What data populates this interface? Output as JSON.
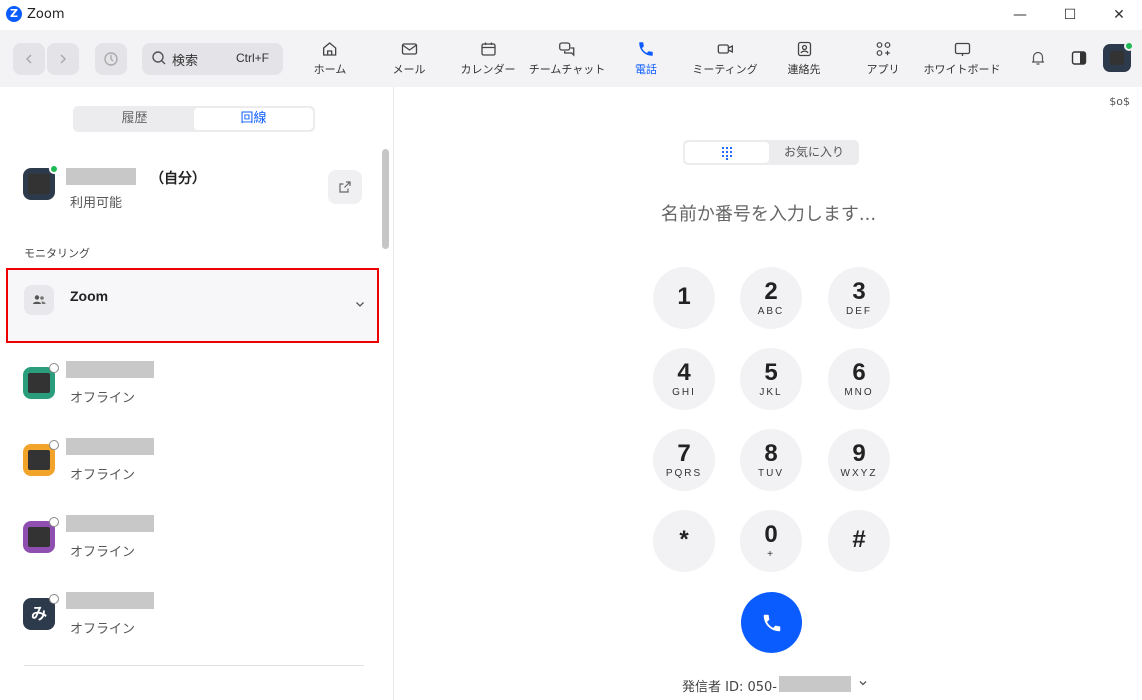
{
  "window": {
    "title": "Zoom",
    "logo_letter": "Z",
    "minimize": "—",
    "maximize": "☐",
    "close": "✕"
  },
  "toolbar": {
    "search_placeholder": "検索",
    "search_shortcut": "Ctrl+F",
    "tabs": [
      {
        "label": "ホーム",
        "icon": "home-icon"
      },
      {
        "label": "メール",
        "icon": "mail-icon"
      },
      {
        "label": "カレンダー",
        "icon": "calendar-icon"
      },
      {
        "label": "チームチャット",
        "icon": "chat-icon"
      },
      {
        "label": "電話",
        "icon": "phone-icon",
        "active": true
      },
      {
        "label": "ミーティング",
        "icon": "video-icon"
      },
      {
        "label": "連絡先",
        "icon": "contacts-icon"
      },
      {
        "label": "アプリ",
        "icon": "apps-icon"
      },
      {
        "label": "ホワイトボード",
        "icon": "whiteboard-icon"
      }
    ]
  },
  "left": {
    "segments": [
      "履歴",
      "回線"
    ],
    "self": {
      "suffix": "（自分）",
      "status": "利用可能"
    },
    "section_heading": "モニタリング",
    "group": {
      "name": "Zoom"
    },
    "contacts": [
      {
        "status": "オフライン",
        "color": "#2a9d7c"
      },
      {
        "status": "オフライン",
        "color": "#f2a32a"
      },
      {
        "status": "オフライン",
        "color": "#8e4fb0"
      },
      {
        "status": "オフライン",
        "color": "#2c3a4b",
        "initial": "み"
      }
    ]
  },
  "dialer": {
    "top_right": "$o$",
    "keypad_tab_icon": "keypad-icon",
    "favorites_label": "お気に入り",
    "input_placeholder": "名前か番号を入力します...",
    "keys": [
      {
        "digit": "1",
        "letters": ""
      },
      {
        "digit": "2",
        "letters": "ABC"
      },
      {
        "digit": "3",
        "letters": "DEF"
      },
      {
        "digit": "4",
        "letters": "GHI"
      },
      {
        "digit": "5",
        "letters": "JKL"
      },
      {
        "digit": "6",
        "letters": "MNO"
      },
      {
        "digit": "7",
        "letters": "PQRS"
      },
      {
        "digit": "8",
        "letters": "TUV"
      },
      {
        "digit": "9",
        "letters": "WXYZ"
      },
      {
        "digit": "*",
        "letters": ""
      },
      {
        "digit": "0",
        "letters": "+"
      },
      {
        "digit": "#",
        "letters": ""
      }
    ],
    "caller_id_label": "発信者 ID: 050-",
    "accent": "#0b5cff"
  }
}
